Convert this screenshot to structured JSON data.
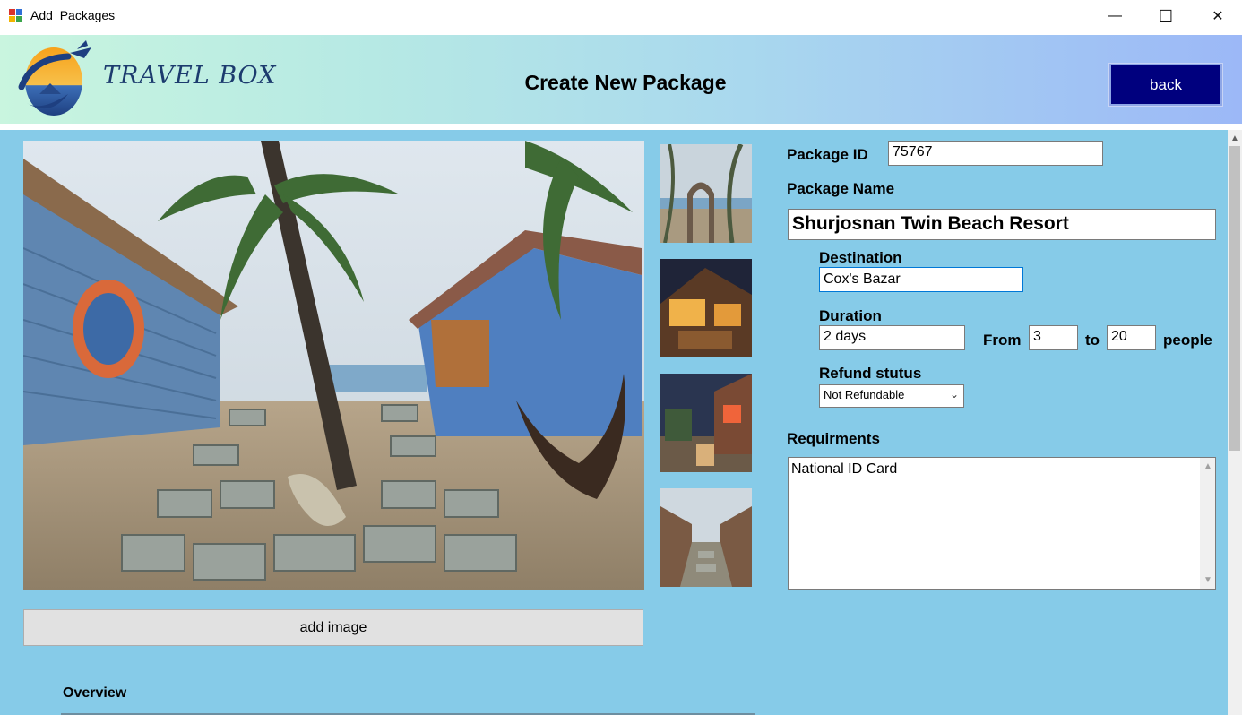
{
  "window": {
    "title": "Add_Packages",
    "minimize_glyph": "—",
    "maximize_glyph": "☐",
    "close_glyph": "✕"
  },
  "header": {
    "brand": "TRAVEL BOX",
    "page_title": "Create New Package",
    "back_label": "back"
  },
  "form": {
    "package_id_label": "Package ID",
    "package_id_value": "75767",
    "package_name_label": "Package Name",
    "package_name_value": "Shurjosnan Twin Beach Resort",
    "destination_label": "Destination",
    "destination_value": "Cox's Bazar",
    "duration_label": "Duration",
    "duration_value": "2 days",
    "from_label": "From",
    "from_value": "3",
    "to_label": "to",
    "to_value": "20",
    "people_label": "people",
    "refund_label": "Refund stutus",
    "refund_value": "Not Refundable",
    "requirements_label": "Requirments",
    "requirements_value": "National ID Card"
  },
  "images": {
    "add_image_label": "add image"
  },
  "overview": {
    "label": "Overview"
  },
  "icons": {
    "app": "app-window-icon",
    "logo": "travel-box-logo",
    "dropdown": "chevron-down-icon"
  },
  "colors": {
    "panel_bg": "#86cbe8",
    "back_button": "#00007e",
    "brand_text": "#1c3b6e"
  }
}
